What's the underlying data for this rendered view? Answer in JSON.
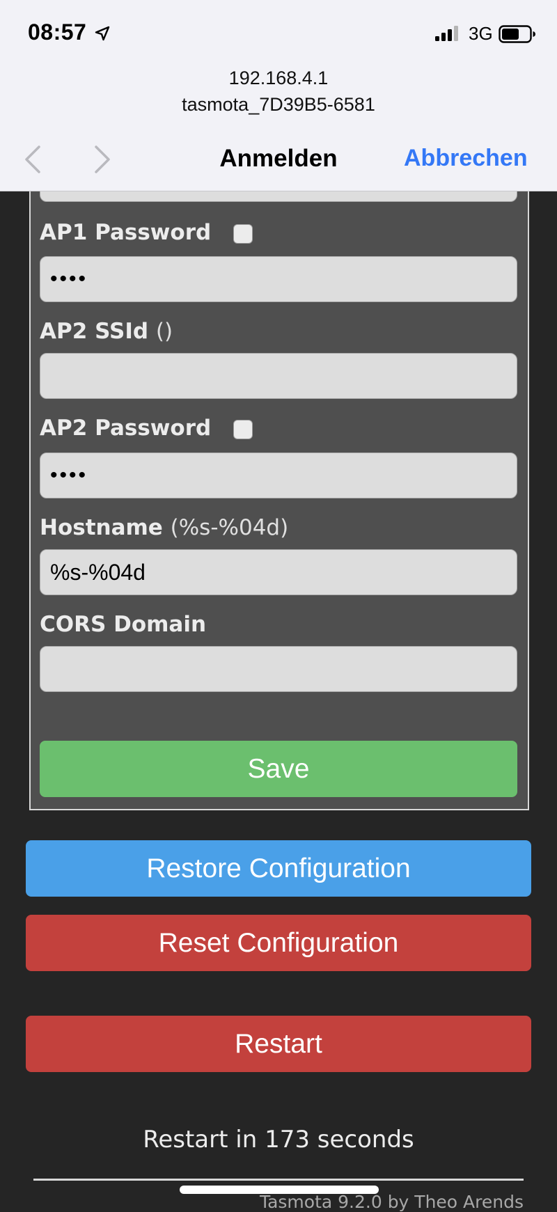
{
  "status_bar": {
    "time": "08:57",
    "network": "3G",
    "icons": [
      "location-arrow-icon",
      "signal-bars-icon",
      "battery-icon"
    ]
  },
  "browser": {
    "host": "192.168.4.1",
    "subtitle": "tasmota_7D39B5-6581",
    "title": "Anmelden",
    "cancel_label": "Abbrechen",
    "accent_color": "#3478f6"
  },
  "form": {
    "ap1_password": {
      "label": "AP1 Password",
      "value": "****"
    },
    "ap2_ssid": {
      "label": "AP2 SSId",
      "hint": "()",
      "value": ""
    },
    "ap2_password": {
      "label": "AP2 Password",
      "value": "****"
    },
    "hostname": {
      "label": "Hostname",
      "hint": "(%s-%04d)",
      "value": "%s-%04d"
    },
    "cors_domain": {
      "label": "CORS Domain",
      "value": ""
    },
    "save_label": "Save"
  },
  "actions": {
    "restore_label": "Restore Configuration",
    "reset_label": "Reset Configuration",
    "restart_label": "Restart"
  },
  "status": {
    "countdown": "Restart in 173 seconds"
  },
  "footer": {
    "text": "Tasmota 9.2.0 by Theo Arends"
  },
  "colors": {
    "save": "#6bbf6e",
    "restore": "#4aa0e8",
    "reset": "#c3413d",
    "page_bg": "#252525",
    "panel_bg": "#4f4f4f"
  }
}
